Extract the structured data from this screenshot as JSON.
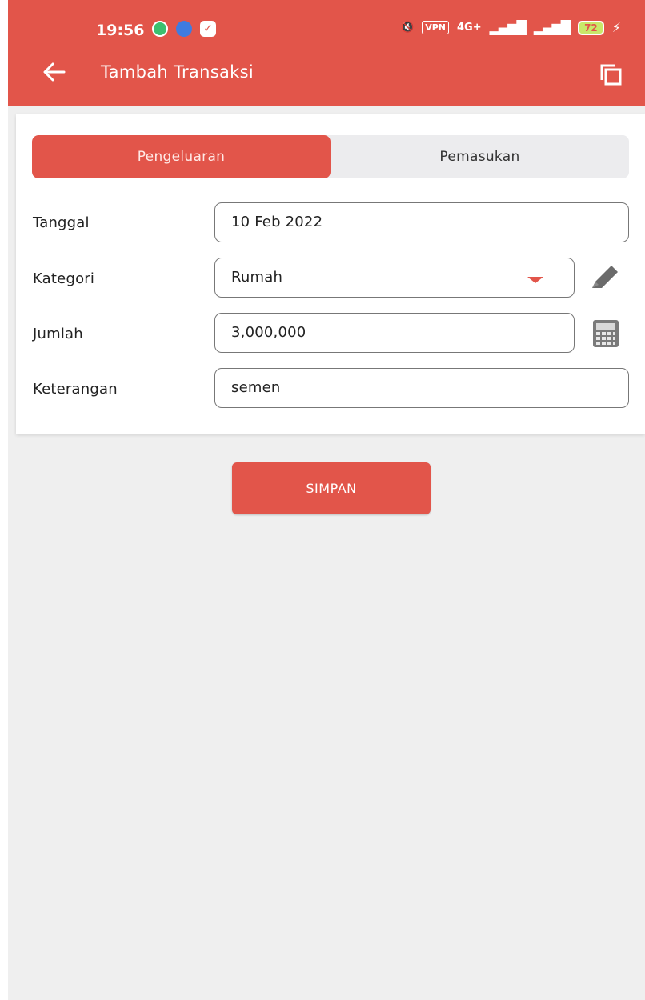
{
  "status_bar": {
    "time": "19:56",
    "vpn": "VPN",
    "network": "4G+",
    "battery": "72"
  },
  "header": {
    "title": "Tambah Transaksi",
    "back_icon": "arrow-left-icon",
    "copy_icon": "copy-icon"
  },
  "tabs": {
    "expense": "Pengeluaran",
    "income": "Pemasukan",
    "active": "Pengeluaran"
  },
  "form": {
    "date": {
      "label": "Tanggal",
      "value": "10 Feb 2022"
    },
    "category": {
      "label": "Kategori",
      "value": "Rumah"
    },
    "amount": {
      "label": "Jumlah",
      "value": "3,000,000"
    },
    "note": {
      "label": "Keterangan",
      "value": "semen"
    }
  },
  "actions": {
    "save": "SIMPAN"
  },
  "colors": {
    "primary": "#e2554a",
    "background": "#efefef",
    "tab_inactive": "#ececee"
  }
}
